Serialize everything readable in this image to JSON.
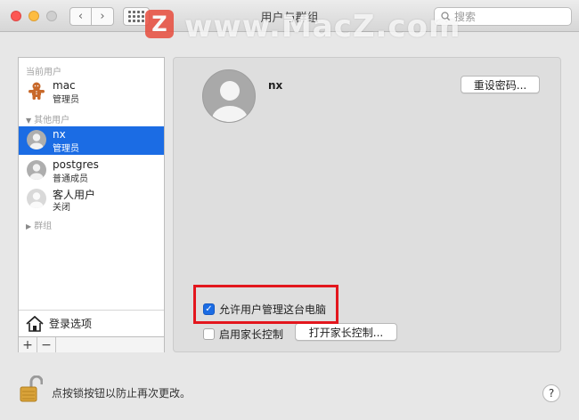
{
  "window": {
    "title": "用户与群组",
    "search_placeholder": "搜索",
    "watermark_logo": "Z",
    "watermark_text": "www.MacZ.com"
  },
  "sidebar": {
    "current_users_label": "当前用户",
    "other_users_label": "其他用户",
    "groups_label": "群组",
    "users": [
      {
        "name": "mac",
        "role": "管理员",
        "avatar_icon": "gingerbread-icon",
        "selected": false
      },
      {
        "name": "nx",
        "role": "管理员",
        "avatar_icon": "user-silhouette-icon",
        "selected": true
      },
      {
        "name": "postgres",
        "role": "普通成员",
        "avatar_icon": "user-silhouette-icon",
        "selected": false
      },
      {
        "name": "客人用户",
        "role": "关闭",
        "avatar_icon": "guest-user-icon",
        "selected": false
      }
    ],
    "login_options_label": "登录选项",
    "add_label": "+",
    "remove_label": "−"
  },
  "panel": {
    "user_name": "nx",
    "reset_password_label": "重设密码...",
    "allow_admin_label": "允许用户管理这台电脑",
    "allow_admin_checked": true,
    "parental_controls_label": "启用家长控制",
    "parental_controls_checked": false,
    "open_parental_label": "打开家长控制..."
  },
  "footer": {
    "lock_text": "点按锁按钮以防止再次更改。",
    "help_label": "?"
  },
  "colors": {
    "selection": "#1b6ce4",
    "highlight_box": "#e3161d",
    "close": "#fc5753",
    "minimize": "#fdbc40"
  }
}
